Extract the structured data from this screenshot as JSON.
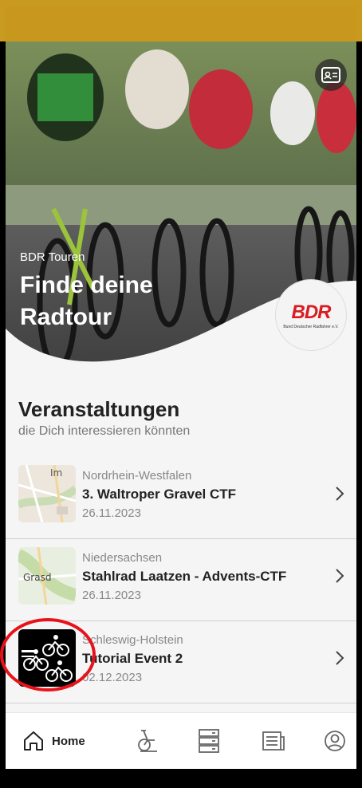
{
  "hero": {
    "subtitle": "BDR Touren",
    "title": "Finde deine Radtour",
    "logo_text": "BDR",
    "logo_caption": "Bund Deutscher Radfahrer e.V.",
    "id_button_icon": "id-card-icon"
  },
  "section": {
    "title": "Veranstaltungen",
    "subtitle": "die Dich interessieren könnten"
  },
  "events": [
    {
      "region": "Nordrhein-Westfalen",
      "name": "3. Waltroper Gravel CTF",
      "date": "26.11.2023",
      "thumb": "map-thumbnail",
      "map_label": "Im"
    },
    {
      "region": "Niedersachsen",
      "name": "Stahlrad Laatzen - Advents-CTF",
      "date": "26.11.2023",
      "thumb": "map-thumbnail",
      "map_label": "Grasd"
    },
    {
      "region": "Schleswig-Holstein",
      "name": "Tutorial Event 2",
      "date": "02.12.2023",
      "thumb": "cyclists-logo"
    }
  ],
  "tabbar": {
    "items": [
      {
        "label": "Home",
        "icon": "home-icon",
        "active": true
      },
      {
        "label": "",
        "icon": "bicycle-icon"
      },
      {
        "label": "",
        "icon": "server-stack-icon"
      },
      {
        "label": "",
        "icon": "newspaper-icon"
      },
      {
        "label": "",
        "icon": "profile-icon"
      }
    ]
  },
  "colors": {
    "status_bar": "#c8981e",
    "highlight": "#e8121b",
    "logo_red": "#d81c22"
  }
}
